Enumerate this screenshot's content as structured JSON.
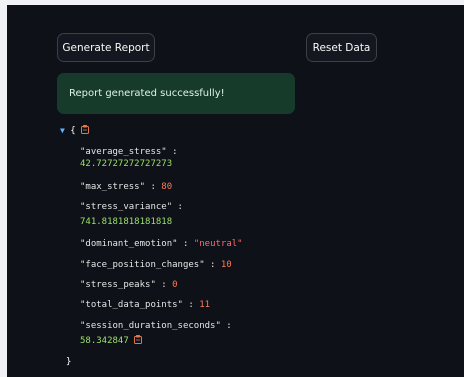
{
  "toolbar": {
    "generate_label": "Generate Report",
    "reset_label": "Reset Data"
  },
  "alert": {
    "message": "Report generated successfully!"
  },
  "json_view": {
    "open_brace": "{",
    "close_brace": "}",
    "entries": [
      {
        "key": "\"average_stress\"",
        "value": "42.72727272727273",
        "type": "float"
      },
      {
        "key": "\"max_stress\"",
        "value": "80",
        "type": "int"
      },
      {
        "key": "\"stress_variance\"",
        "value": "741.8181818181818",
        "type": "float"
      },
      {
        "key": "\"dominant_emotion\"",
        "value": "\"neutral\"",
        "type": "string"
      },
      {
        "key": "\"face_position_changes\"",
        "value": "10",
        "type": "int"
      },
      {
        "key": "\"stress_peaks\"",
        "value": "0",
        "type": "int"
      },
      {
        "key": "\"total_data_points\"",
        "value": "11",
        "type": "int"
      },
      {
        "key": "\"session_duration_seconds\"",
        "value": "58.342847",
        "type": "float"
      }
    ]
  },
  "colors": {
    "background": "#0e1117",
    "success_bg": "#173b2b",
    "int_value": "#ff7b54",
    "float_value": "#9be26b",
    "string_value": "#ff6a6a"
  },
  "icons": {
    "toggle": "caret-down-icon",
    "copy": "clipboard-icon"
  }
}
